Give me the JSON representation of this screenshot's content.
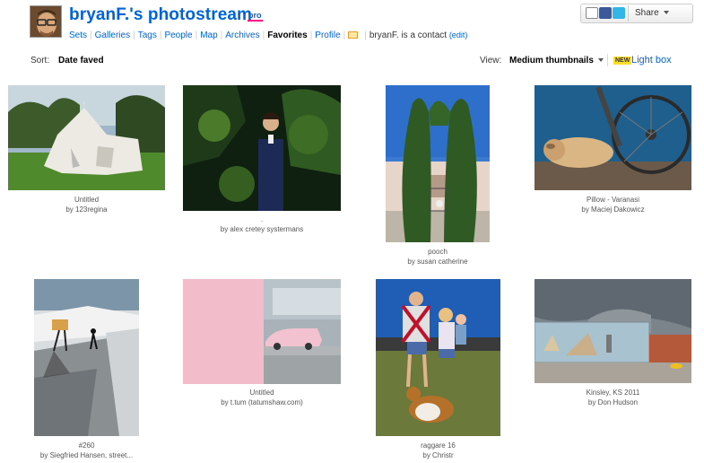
{
  "header": {
    "title": "bryanF.'s photostream",
    "pro_badge": "pro",
    "nav": [
      "Sets",
      "Galleries",
      "Tags",
      "People",
      "Map",
      "Archives",
      "Favorites",
      "Profile"
    ],
    "active_nav": "Favorites",
    "contact_text": "bryanF. is a contact",
    "edit_link": "(edit)",
    "share_label": "Share",
    "colors": {
      "brand": "#0063dc",
      "accent": "#ff0084"
    }
  },
  "toolbar": {
    "sort_label": "Sort:",
    "sort_value": "Date faved",
    "view_label": "View:",
    "view_value": "Medium thumbnails",
    "new_badge": "NEW",
    "lightbox_label": "Light box"
  },
  "photos": [
    {
      "title": "Untitled",
      "author": "by 123regina"
    },
    {
      "title": ".",
      "author": "by alex cretey systermans"
    },
    {
      "title": "pooch",
      "author": "by susan catherine"
    },
    {
      "title": "Pillow - Varanasi",
      "author": "by Maciej Dakowicz"
    },
    {
      "title": "#260",
      "author": "by Siegfried Hansen, street..."
    },
    {
      "title": "Untitled",
      "author": "by t.tum (tatumshaw.com)"
    },
    {
      "title": "raggare 16",
      "author": "by Christr"
    },
    {
      "title": "Kinsley, KS 2011",
      "author": "by Don Hudson"
    }
  ]
}
